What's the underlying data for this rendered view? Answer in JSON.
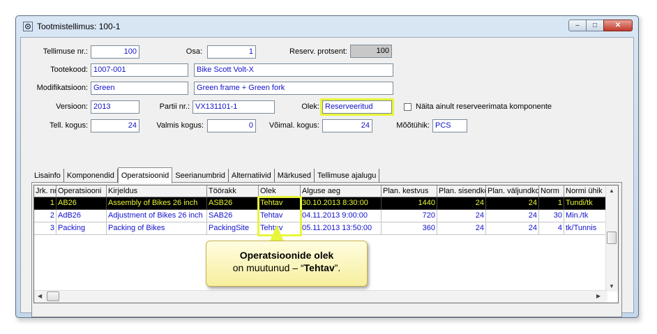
{
  "window": {
    "title": "Tootmistellimus: 100-1",
    "buttons": {
      "minimize": "–",
      "maximize": "□",
      "close": "✕"
    }
  },
  "form": {
    "order_no": {
      "label": "Tellimuse nr.:",
      "value": "100"
    },
    "part": {
      "label": "Osa:",
      "value": "1"
    },
    "reserve_percent": {
      "label": "Reserv. protsent:",
      "value": "100"
    },
    "product_code": {
      "label": "Tootekood:",
      "value": "1007-001",
      "name": "Bike Scott Volt-X"
    },
    "modification": {
      "label": "Modifikatsioon:",
      "value": "Green",
      "desc": "Green frame + Green fork"
    },
    "version": {
      "label": "Versioon:",
      "value": "2013"
    },
    "batch_no": {
      "label": "Partii nr.:",
      "value": "VX131101-1"
    },
    "status": {
      "label": "Olek:",
      "value": "Reserveeritud"
    },
    "show_unreserved": {
      "label": "Näita ainult reserveerimata komponente",
      "checked": false
    },
    "order_qty": {
      "label": "Tell. kogus:",
      "value": "24"
    },
    "done_qty": {
      "label": "Valmis kogus:",
      "value": "0"
    },
    "possible_qty": {
      "label": "Võimal. kogus:",
      "value": "24"
    },
    "unit": {
      "label": "Mõõtühik:",
      "value": "PCS"
    }
  },
  "tabs": [
    {
      "label": "Lisainfo",
      "active": false
    },
    {
      "label": "Komponendid",
      "active": false
    },
    {
      "label": "Operatsioonid",
      "active": true
    },
    {
      "label": "Seerianumbrid",
      "active": false
    },
    {
      "label": "Alternatiivid",
      "active": false
    },
    {
      "label": "Märkused",
      "active": false
    },
    {
      "label": "Tellimuse ajalugu",
      "active": false
    }
  ],
  "grid": {
    "columns": [
      "Jrk. nr",
      "Operatsiooni",
      "Kirjeldus",
      "Töörakk",
      "Olek",
      "Alguse aeg",
      "Plan. kestvus",
      "Plan. sisendkogus",
      "Plan. väljundkogus",
      "Norm",
      "Normi ühik"
    ],
    "rows": [
      [
        "1",
        "AB26",
        "Assembly of Bikes 26 inch",
        "ASB26",
        "Tehtav",
        "30.10.2013 8:30:00",
        "1440",
        "24",
        "24",
        "1",
        "Tundi/tk"
      ],
      [
        "2",
        "AdB26",
        "Adjustment of Bikes 26 inch",
        "SAB26",
        "Tehtav",
        "04.11.2013 9:00:00",
        "720",
        "24",
        "24",
        "30",
        "Min./tk"
      ],
      [
        "3",
        "Packing",
        "Packing of Bikes",
        "PackingSite",
        "Tehtav",
        "05.11.2013 13:50:00",
        "360",
        "24",
        "24",
        "4",
        "tk/Tunnis"
      ]
    ],
    "selected_row": 0
  },
  "callout": {
    "title": "Operatsioonide olek",
    "text_prefix": "on muutunud  –  “",
    "text_bold": "Tehtav",
    "text_suffix": "”."
  },
  "colors": {
    "highlight": "#e8f53a",
    "field_text": "#1111cc",
    "selected_row_bg": "#000000",
    "selected_row_text": "#e8f53a"
  }
}
